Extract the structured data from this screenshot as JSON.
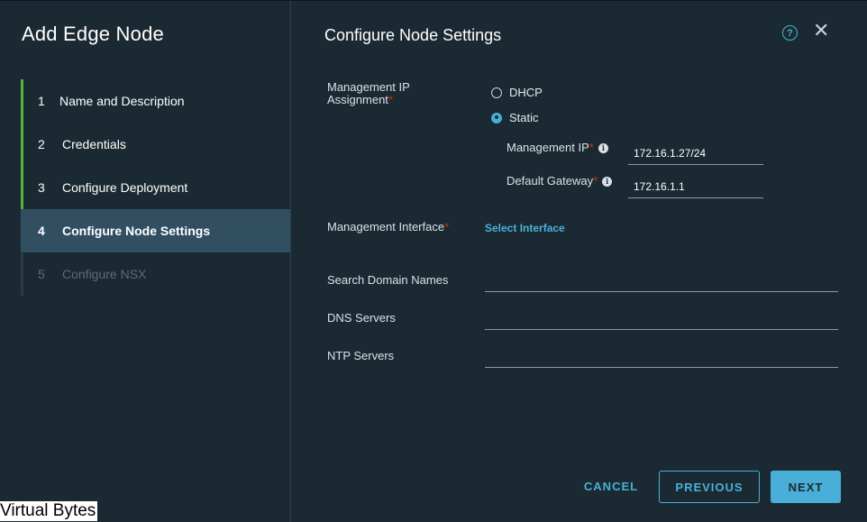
{
  "sidebar": {
    "title": "Add Edge Node",
    "steps": [
      {
        "num": "1",
        "label": "Name and Description"
      },
      {
        "num": "2",
        "label": "Credentials"
      },
      {
        "num": "3",
        "label": "Configure Deployment"
      },
      {
        "num": "4",
        "label": "Configure Node Settings"
      },
      {
        "num": "5",
        "label": "Configure NSX"
      }
    ]
  },
  "main": {
    "title": "Configure Node Settings",
    "help_icon": "question-circle-icon",
    "close_icon": "close-icon",
    "mgmt_ip_assignment": {
      "label_line1": "Management IP",
      "label_line2": "Assignment",
      "options": [
        "DHCP",
        "Static"
      ],
      "selected": "Static"
    },
    "mgmt_ip": {
      "label": "Management IP",
      "value": "172.16.1.27/24"
    },
    "default_gateway": {
      "label": "Default Gateway",
      "value": "172.16.1.1"
    },
    "mgmt_interface": {
      "label": "Management Interface",
      "link": "Select Interface"
    },
    "search_domain": {
      "label": "Search Domain Names",
      "value": ""
    },
    "dns_servers": {
      "label": "DNS Servers",
      "value": ""
    },
    "ntp_servers": {
      "label": "NTP Servers",
      "value": ""
    },
    "required_marker": "*"
  },
  "footer": {
    "cancel": "CANCEL",
    "previous": "PREVIOUS",
    "next": "NEXT"
  },
  "watermark": "Virtual Bytes",
  "colors": {
    "background": "#1b2a32",
    "accent": "#49afd9",
    "step_complete": "#59b33b",
    "active_step": "#324f62",
    "required": "#e62700"
  }
}
